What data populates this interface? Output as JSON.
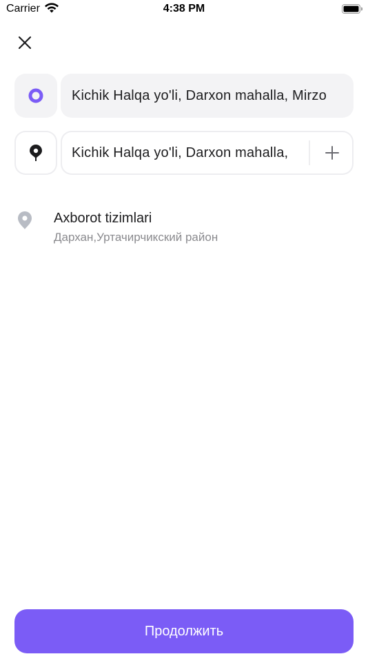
{
  "status_bar": {
    "carrier": "Carrier",
    "time": "4:38 PM"
  },
  "icons": {
    "close": "close-icon",
    "from_marker": "origin-dot-icon",
    "to_marker": "destination-pin-icon",
    "add_stop": "plus-icon",
    "suggestion_pin": "location-pin-icon"
  },
  "route": {
    "from_address": "Kichik Halqa yo'li, Darxon mahalla, Mirzo",
    "to_address": "Kichik Halqa yo'li, Darxon mahalla,"
  },
  "suggestions": [
    {
      "title": "Axborot tizimlari",
      "subtitle": "Дархан,Уртачирчикский район"
    }
  ],
  "footer": {
    "continue_label": "Продолжить"
  },
  "colors": {
    "accent": "#7b5cf6",
    "field_background": "#f3f3f5",
    "secondary_text": "#8a8a8e",
    "pin_gray": "#b8bcc4"
  }
}
